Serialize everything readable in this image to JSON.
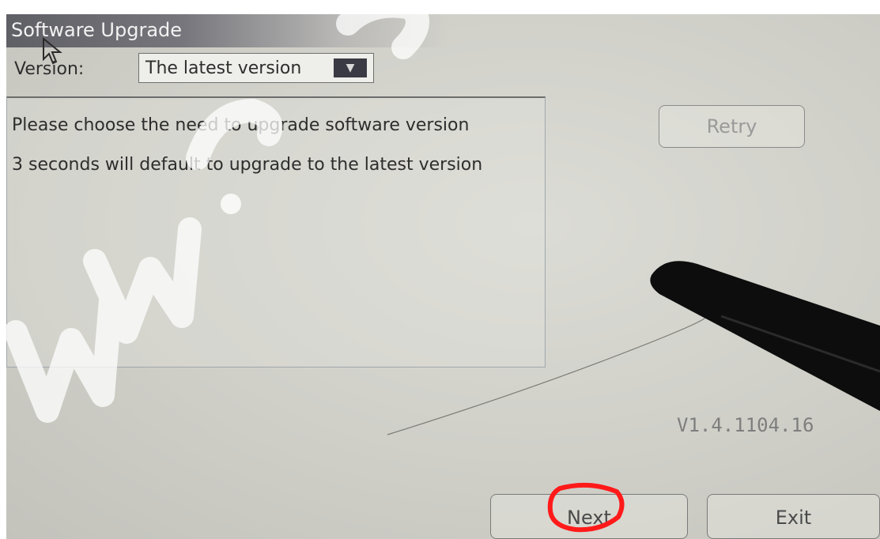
{
  "window": {
    "title": "Software Upgrade"
  },
  "version_picker": {
    "label": "Version:",
    "selected_value": "The latest version",
    "arrow_icon": "chevron-down-icon"
  },
  "message": {
    "lines": [
      "Please choose the need to upgrade software version",
      "3 seconds will default to upgrade to the latest version"
    ]
  },
  "buttons": {
    "retry_label": "Retry",
    "next_label": "Next",
    "exit_label": "Exit"
  },
  "firmware_version": "V1.4.1104.16",
  "colors": {
    "titlebar": "#5f5f66",
    "highlight_circle": "#ff1a1a",
    "watermark": "#ffffff"
  }
}
